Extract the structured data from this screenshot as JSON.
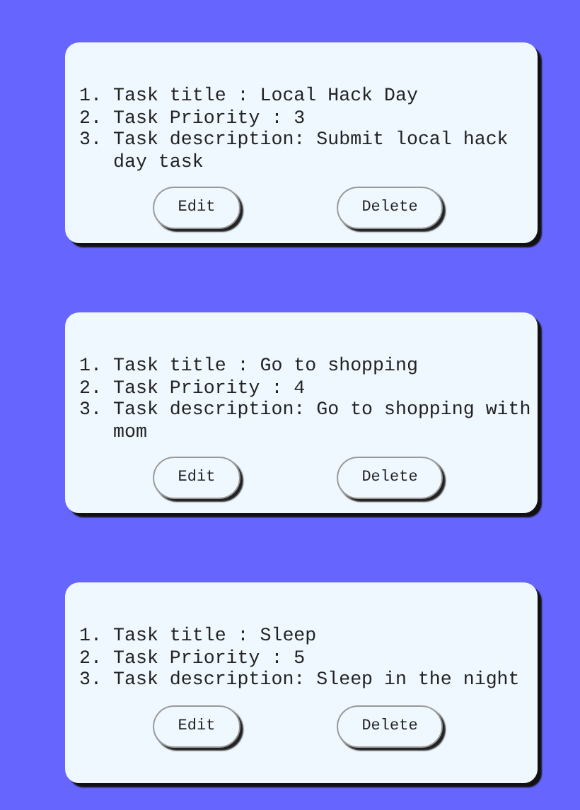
{
  "tasks": [
    {
      "lines": [
        {
          "marker": "1.",
          "text": "Task title : Local Hack Day"
        },
        {
          "marker": "2.",
          "text": "Task Priority : 3"
        },
        {
          "marker": "3.",
          "text": "Task description: Submit local hack day task"
        }
      ],
      "buttons": [
        "Edit",
        "Delete"
      ]
    },
    {
      "lines": [
        {
          "marker": "1.",
          "text": "Task title : Go to shopping"
        },
        {
          "marker": "2.",
          "text": "Task Priority : 4"
        },
        {
          "marker": "3.",
          "text": "Task description: Go to shopping with mom"
        }
      ],
      "buttons": [
        "Edit",
        "Delete"
      ]
    },
    {
      "lines": [
        {
          "marker": "1.",
          "text": "Task title : Sleep"
        },
        {
          "marker": "2.",
          "text": "Task Priority : 5"
        },
        {
          "marker": "3.",
          "text": "Task description: Sleep in the night"
        }
      ],
      "buttons": [
        "Edit",
        "Delete"
      ]
    }
  ]
}
